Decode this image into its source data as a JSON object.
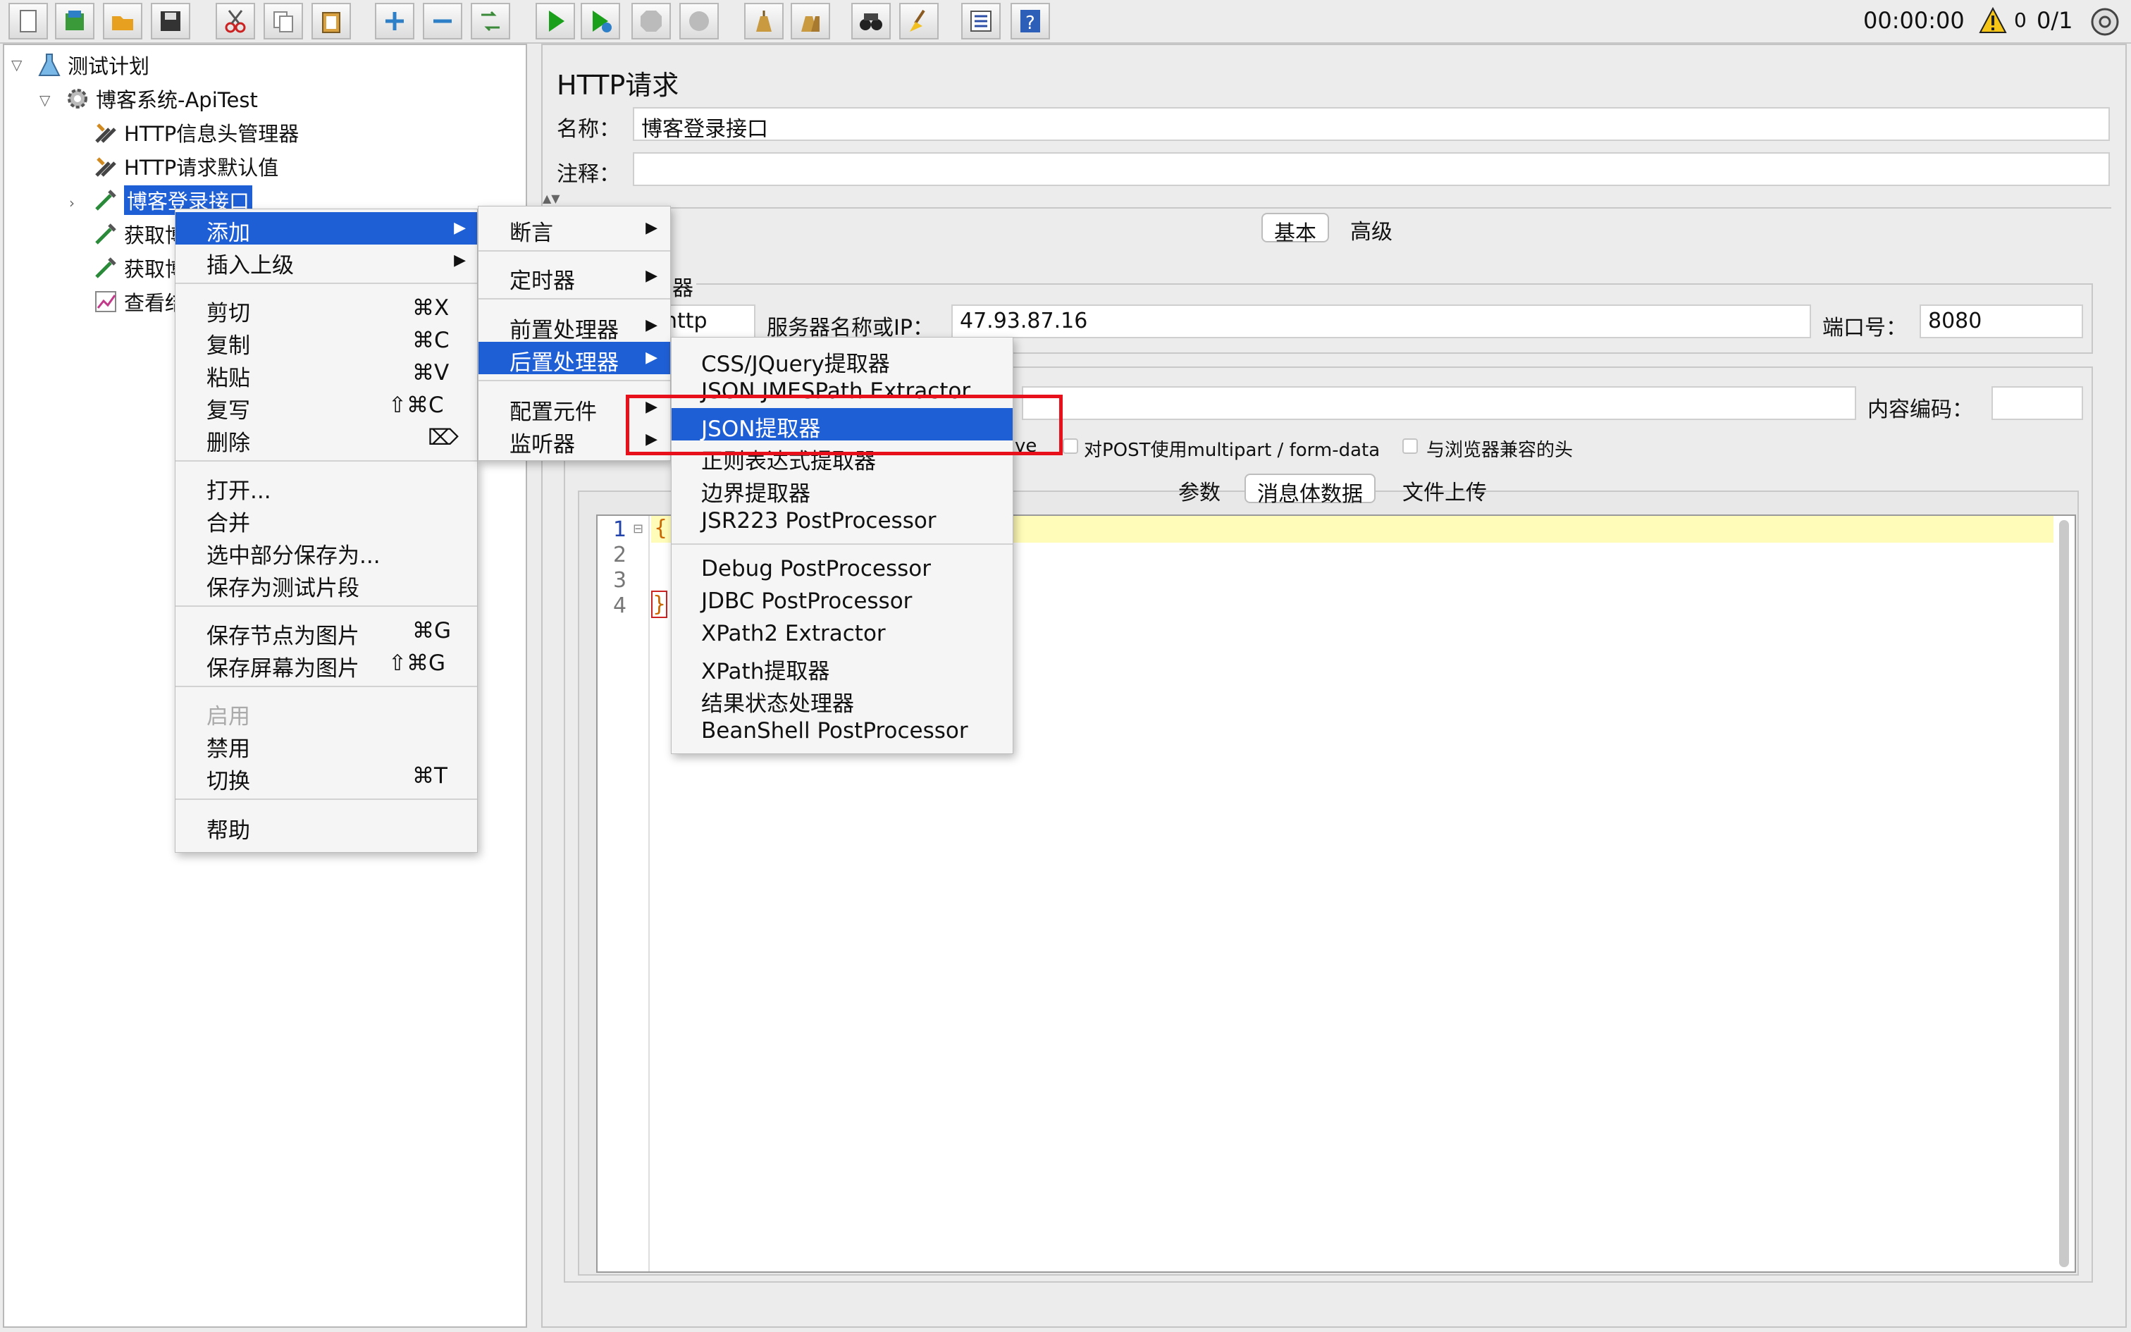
{
  "toolbar": {
    "buttons": [
      "new-icon",
      "templates-icon",
      "open-icon",
      "save-icon",
      "cut-icon",
      "copy-icon",
      "paste-icon",
      "expand-icon",
      "collapse-icon",
      "toggle-icon",
      "start-icon",
      "start-no-pause-icon",
      "stop-icon",
      "shutdown-icon",
      "clear-icon",
      "clear-all-icon",
      "search-icon",
      "reset-search-icon",
      "function-helper-icon",
      "help-icon"
    ],
    "timer": "00:00:00",
    "warning_count": "0",
    "threads": "0/1"
  },
  "tree": {
    "root": "测试计划",
    "thread_group": "博客系统-ApiTest",
    "header_manager": "HTTP信息头管理器",
    "request_defaults": "HTTP请求默认值",
    "selected_node": "博客登录接口",
    "node_get_1": "获取博",
    "node_get_2": "获取博",
    "node_view": "查看结"
  },
  "panel": {
    "title": "HTTP请求",
    "name_label": "名称：",
    "name_value": "博客登录接口",
    "comment_label": "注释：",
    "comment_value": "",
    "tab_basic": "基本",
    "tab_advanced": "高级",
    "web_server_group": "器",
    "protocol_value": "http",
    "server_label": "服务器名称或IP：",
    "server_value": "47.93.87.16",
    "port_label": "端口号：",
    "port_value": "8080",
    "encoding_label": "内容编码：",
    "encoding_value": "",
    "keepalive_fragment": "ve",
    "multipart_label": "对POST使用multipart / form-data",
    "browser_headers_label": "与浏览器兼容的头",
    "subtab_params": "参数",
    "subtab_body": "消息体数据",
    "subtab_files": "文件上传",
    "editor_lines": [
      "1",
      "2",
      "3",
      "4"
    ],
    "editor_open_brace": "{",
    "editor_close_brace": "}"
  },
  "context_menu": {
    "add": "添加",
    "insert_parent": "插入上级",
    "cut": "剪切",
    "cut_sc": "⌘X",
    "copy": "复制",
    "copy_sc": "⌘C",
    "paste": "粘贴",
    "paste_sc": "⌘V",
    "duplicate": "复写",
    "duplicate_sc": "⇧⌘C",
    "delete": "删除",
    "delete_sc": "⌦",
    "open": "打开...",
    "merge": "合并",
    "save_selection": "选中部分保存为...",
    "save_fragment": "保存为测试片段",
    "save_node_image": "保存节点为图片",
    "save_node_image_sc": "⌘G",
    "save_screen_image": "保存屏幕为图片",
    "save_screen_image_sc": "⇧⌘G",
    "enable": "启用",
    "disable": "禁用",
    "toggle": "切换",
    "toggle_sc": "⌘T",
    "help": "帮助"
  },
  "add_submenu": {
    "assertion": "断言",
    "timer": "定时器",
    "preprocessor": "前置处理器",
    "postprocessor": "后置处理器",
    "config": "配置元件",
    "listener": "监听器"
  },
  "post_submenu": {
    "css": "CSS/JQuery提取器",
    "jmespath": "JSON JMESPath Extractor",
    "json": "JSON提取器",
    "regex": "正则表达式提取器",
    "boundary": "边界提取器",
    "jsr223": "JSR223 PostProcessor",
    "debug": "Debug PostProcessor",
    "jdbc": "JDBC PostProcessor",
    "xpath2": "XPath2 Extractor",
    "xpath": "XPath提取器",
    "result_status": "结果状态处理器",
    "beanshell": "BeanShell PostProcessor"
  },
  "colors": {
    "selection": "#1f5fd6",
    "highlight": "#e8101a",
    "editor_line": "#fffbb8"
  }
}
